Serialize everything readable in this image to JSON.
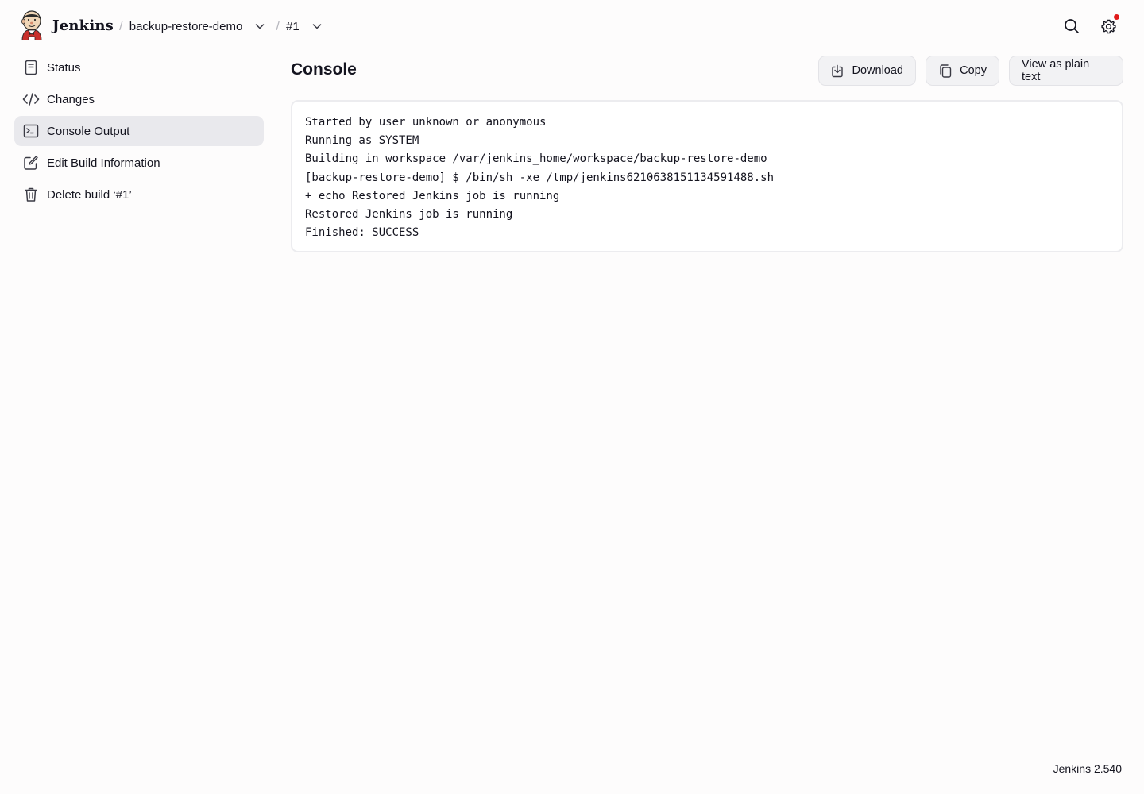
{
  "header": {
    "brand": "Jenkins",
    "breadcrumbs": [
      {
        "label": "backup-restore-demo"
      },
      {
        "label": "#1"
      }
    ],
    "separator": "/",
    "notification_color": "#e01a1a"
  },
  "icons": {
    "search": "search-icon",
    "settings": "gear-icon",
    "chevron": "chevron-down-icon"
  },
  "sidebar": {
    "items": [
      {
        "label": "Status",
        "icon": "document-icon",
        "active": false
      },
      {
        "label": "Changes",
        "icon": "code-icon",
        "active": false
      },
      {
        "label": "Console Output",
        "icon": "terminal-icon",
        "active": true
      },
      {
        "label": "Edit Build Information",
        "icon": "edit-icon",
        "active": false
      },
      {
        "label": "Delete build ‘#1’",
        "icon": "trash-icon",
        "active": false
      }
    ]
  },
  "main": {
    "title": "Console",
    "buttons": {
      "download": "Download",
      "copy": "Copy",
      "plain": "View as plain text"
    },
    "console_lines": [
      "Started by user unknown or anonymous",
      "Running as SYSTEM",
      "Building in workspace /var/jenkins_home/workspace/backup-restore-demo",
      "[backup-restore-demo] $ /bin/sh -xe /tmp/jenkins6210638151134591488.sh",
      "+ echo Restored Jenkins job is running",
      "Restored Jenkins job is running",
      "Finished: SUCCESS"
    ]
  },
  "footer": {
    "version": "Jenkins 2.540"
  }
}
